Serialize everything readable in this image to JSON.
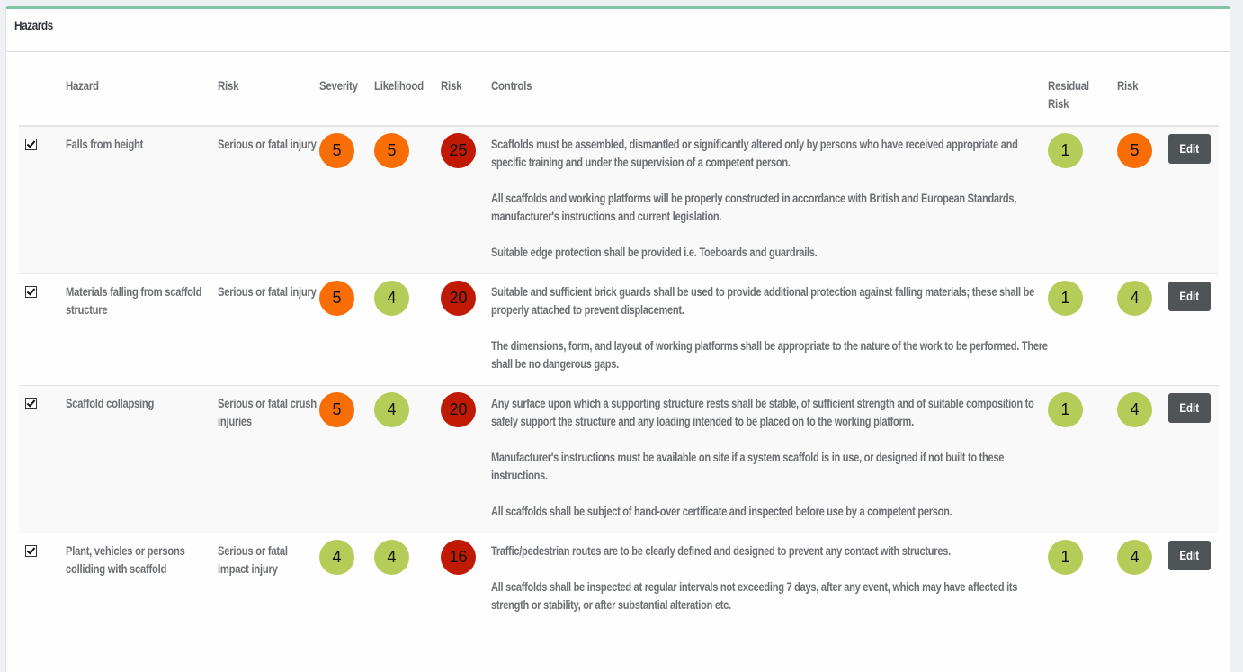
{
  "panel": {
    "title": "Hazards",
    "accent_color": "#80c4a5"
  },
  "colors": {
    "low": "#b5cc58",
    "medium": "#f96d05",
    "high": "#c01a05"
  },
  "table": {
    "headers": {
      "hazard": "Hazard",
      "risk": "Risk",
      "severity": "Severity",
      "likelihood": "Likelihood",
      "risk_score": "Risk",
      "controls": "Controls",
      "residual_risk": "Residual Risk",
      "residual_risk_score": "Risk"
    },
    "edit_label": "Edit",
    "rows": [
      {
        "checked": true,
        "hazard": "Falls from height",
        "risk": "Serious or fatal injury",
        "severity": {
          "value": "5",
          "level": "medium"
        },
        "likelihood": {
          "value": "5",
          "level": "medium"
        },
        "risk_score": {
          "value": "25",
          "level": "high"
        },
        "controls": [
          "Scaffolds must be assembled, dismantled or significantly altered only by persons who have received appropriate and specific training and under the supervision of a competent person.",
          "All scaffolds and working platforms will be properly constructed in accordance with British and European Standards, manufacturer's instructions and current legislation.",
          "Suitable edge protection shall be provided i.e. Toeboards and guardrails."
        ],
        "residual_risk": {
          "value": "1",
          "level": "low"
        },
        "residual_risk_score": {
          "value": "5",
          "level": "medium"
        }
      },
      {
        "checked": true,
        "hazard": "Materials falling from scaffold structure",
        "risk": "Serious or fatal injury",
        "severity": {
          "value": "5",
          "level": "medium"
        },
        "likelihood": {
          "value": "4",
          "level": "low"
        },
        "risk_score": {
          "value": "20",
          "level": "high"
        },
        "controls": [
          "Suitable and sufficient brick guards shall be used to provide additional protection against falling materials; these shall be properly attached to prevent displacement.",
          "The dimensions, form, and layout of working platforms shall be appropriate to the nature of the work to be performed. There shall be no dangerous gaps."
        ],
        "residual_risk": {
          "value": "1",
          "level": "low"
        },
        "residual_risk_score": {
          "value": "4",
          "level": "low"
        }
      },
      {
        "checked": true,
        "hazard": "Scaffold collapsing",
        "risk": "Serious or fatal crush injuries",
        "severity": {
          "value": "5",
          "level": "medium"
        },
        "likelihood": {
          "value": "4",
          "level": "low"
        },
        "risk_score": {
          "value": "20",
          "level": "high"
        },
        "controls": [
          "Any surface upon which a supporting structure rests shall be stable, of sufficient strength and of suitable composition to safely support the structure and any loading intended to be placed on to the working platform.",
          "Manufacturer's instructions must be available on site if a system scaffold is in use, or designed if not built to these instructions.",
          "All scaffolds shall be subject of hand-over certificate and inspected before use by a competent person."
        ],
        "residual_risk": {
          "value": "1",
          "level": "low"
        },
        "residual_risk_score": {
          "value": "4",
          "level": "low"
        }
      },
      {
        "checked": true,
        "hazard": "Plant, vehicles or persons colliding with scaffold",
        "risk": "Serious or fatal impact injury",
        "severity": {
          "value": "4",
          "level": "low"
        },
        "likelihood": {
          "value": "4",
          "level": "low"
        },
        "risk_score": {
          "value": "16",
          "level": "high"
        },
        "controls": [
          "Traffic/pedestrian routes are to be clearly defined and designed to prevent any contact with structures.",
          "All scaffolds shall be inspected at regular intervals not exceeding 7 days, after any event, which may have affected its strength or stability, or after substantial alteration etc."
        ],
        "residual_risk": {
          "value": "1",
          "level": "low"
        },
        "residual_risk_score": {
          "value": "4",
          "level": "low"
        }
      }
    ]
  }
}
